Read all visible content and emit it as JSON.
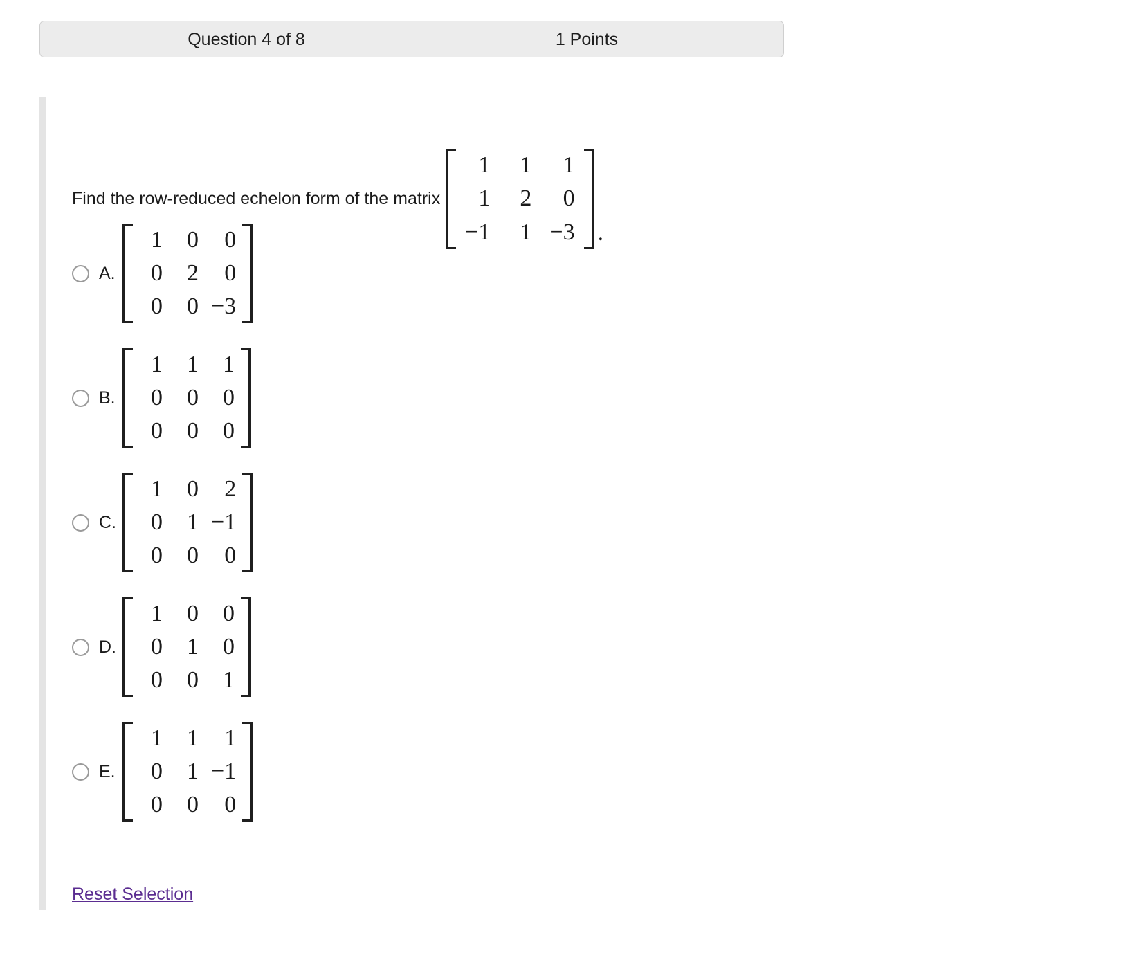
{
  "header": {
    "question_label": "Question 4 of 8",
    "points_label": "1 Points"
  },
  "question": {
    "stem_text": "Find the row-reduced echelon form of the matrix",
    "trailing_punctuation": ".",
    "matrix": [
      [
        "1",
        "1",
        "1"
      ],
      [
        "1",
        "2",
        "0"
      ],
      [
        "−1",
        "1",
        "−3"
      ]
    ]
  },
  "options": [
    {
      "letter": "A.",
      "matrix": [
        [
          "1",
          "0",
          "0"
        ],
        [
          "0",
          "2",
          "0"
        ],
        [
          "0",
          "0",
          "−3"
        ]
      ]
    },
    {
      "letter": "B.",
      "matrix": [
        [
          "1",
          "1",
          "1"
        ],
        [
          "0",
          "0",
          "0"
        ],
        [
          "0",
          "0",
          "0"
        ]
      ]
    },
    {
      "letter": "C.",
      "matrix": [
        [
          "1",
          "0",
          "2"
        ],
        [
          "0",
          "1",
          "−1"
        ],
        [
          "0",
          "0",
          "0"
        ]
      ]
    },
    {
      "letter": "D.",
      "matrix": [
        [
          "1",
          "0",
          "0"
        ],
        [
          "0",
          "1",
          "0"
        ],
        [
          "0",
          "0",
          "1"
        ]
      ]
    },
    {
      "letter": "E.",
      "matrix": [
        [
          "1",
          "1",
          "1"
        ],
        [
          "0",
          "1",
          "−1"
        ],
        [
          "0",
          "0",
          "0"
        ]
      ]
    }
  ],
  "actions": {
    "reset_label": "Reset Selection"
  },
  "colors": {
    "header_background": "#ececec",
    "header_border": "#cfcfcf",
    "link": "#5b2d91",
    "rail": "#e4e4e4",
    "text": "#1a1a1a"
  }
}
